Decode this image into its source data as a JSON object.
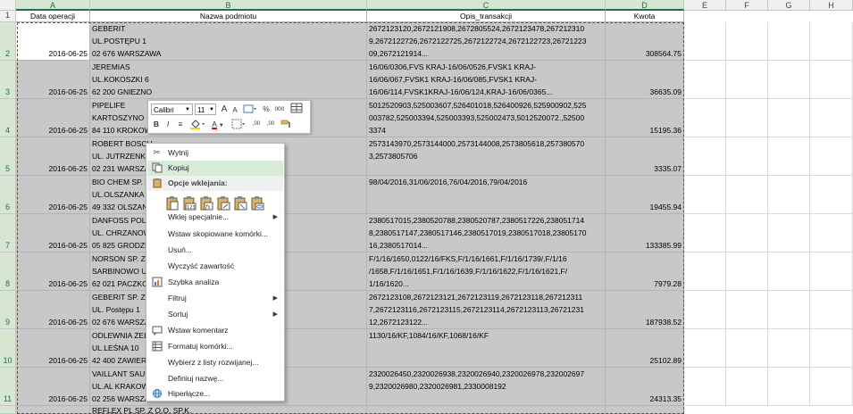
{
  "columns": [
    "A",
    "B",
    "C",
    "D",
    "E",
    "F",
    "G",
    "H"
  ],
  "rows": [
    "1",
    "2",
    "3",
    "4",
    "5",
    "6",
    "7",
    "8",
    "9",
    "10",
    "11"
  ],
  "headers": {
    "a": "Data operacji",
    "b": "Nazwa podmiotu",
    "c": "Opis_transakcji",
    "d": "Kwota"
  },
  "data_rows": [
    {
      "date": "2016-06-25",
      "name": [
        "GEBERIT",
        "UL.POSTĘPU 1",
        "02 676 WARSZAWA"
      ],
      "desc": [
        "2672123120,2672121908,2672805524,2672123478,267212310",
        "9,2672122726,2672122725,2672122724,2672122723,26721223",
        "09,2672121914..."
      ],
      "amount": "308564.75"
    },
    {
      "date": "2016-06-25",
      "name": [
        "JEREMIAS",
        "UL.KOKOSZKI 6",
        "62 200 GNIEZNO"
      ],
      "desc": [
        "16/06/0306,FVS KRAJ-16/06/0526,FVSK1 KRAJ-",
        "16/06/067,FVSK1 KRAJ-16/06/085,FVSK1 KRAJ-",
        "16/06/114,FVSK1KRAJ-16/06/124,KRAJ-16/06/0365..."
      ],
      "amount": "36635.09"
    },
    {
      "date": "2016-06-25",
      "name": [
        "PIPELIFE",
        "KARTOSZYNO",
        "84 110 KROKOWA"
      ],
      "desc": [
        "5012520903,525003607,526401018,526400926,525900902,525",
        "003782,525003394,525003393,525002473,5012520072.,52500",
        "3374"
      ],
      "amount": "15195.36"
    },
    {
      "date": "2016-06-25",
      "name": [
        "ROBERT BOSCH",
        "UL. JUTRZENKI",
        "02 231 WARSZAWA"
      ],
      "desc": [
        "",
        "2573143970,2573144000,2573144008,2573805618,257380570",
        "3,2573805706"
      ],
      "amount": "3335.07"
    },
    {
      "date": "2016-06-25",
      "name": [
        "BIO CHEM SP. Z",
        "UL.OLSZANKA",
        "49 332 OLSZANKA"
      ],
      "desc": [
        "",
        "",
        "98/04/2016,31/06/2016,76/04/2016,79/04/2016"
      ],
      "amount": "19455.94"
    },
    {
      "date": "2016-06-25",
      "name": [
        "DANFOSS POLAND",
        "UL. CHRZANOWSKA",
        "05 825 GRODZISK"
      ],
      "desc": [
        "2380517015,2380520788,2380520787,2380517226,238051714",
        "8,2380517147,2380517146,2380517019,2380517018,23805170",
        "16,2380517014..."
      ],
      "amount": "133385.99"
    },
    {
      "date": "2016-06-25",
      "name": [
        "NORSON SP. Z",
        "SARBINOWO UL.",
        "62 021 PACZKOWO"
      ],
      "desc": [
        "F/1/16/1650,0122/16/FKS,F/1/16/1661,F/1/16/1739/,F/1/16",
        "/1658,F/1/16/1651,F/1/16/1639,F/1/16/1622,F/1/16/1621,F/",
        "1/16/1620..."
      ],
      "amount": "7979.28"
    },
    {
      "date": "2016-06-25",
      "name": [
        "GEBERIT SP. Z",
        "UL. Postępu 1",
        "02 676 WARSZAWA"
      ],
      "desc": [
        "2672123108,2672123121,2672123119,2672123118,267212311",
        "7,2672123116,2672123115,2672123114,2672123113,26721231",
        "12,2672123122..."
      ],
      "amount": "187938.52"
    },
    {
      "date": "2016-06-25",
      "name": [
        "ODLEWNIA ŻELIWA",
        "UL.LEŚNA 10",
        "42 400 ZAWIERCIE"
      ],
      "desc": [
        "",
        "",
        "1130/16/KF,1084/16/KF,1068/16/KF"
      ],
      "amount": "25102.89"
    },
    {
      "date": "2016-06-25",
      "name": [
        "VAILLANT SAUNIER",
        "UL.AL KRAKOWSKA",
        "02 256 WARSZAWA"
      ],
      "desc": [
        "",
        "2320026450,2320026938,2320026940,2320026978,232002697",
        "9,2320026980,2320026981,2330008192"
      ],
      "amount": "24313.35"
    }
  ],
  "partial_row": {
    "name": "REFLEX PL SP. Z O.O. SP.K."
  },
  "mini_toolbar": {
    "font_name": "Calibri",
    "font_size": "11",
    "grow_font": "A",
    "shrink_font": "A",
    "percent": "%",
    "thousands": "000",
    "bold": "B",
    "italic": "I",
    "font_color": "A",
    "dec_inc": ",00",
    "dec_dec": ",00"
  },
  "context_menu": {
    "cut": "Wytnij",
    "copy": "Kopiuj",
    "paste_options_header": "Opcje wklejania:",
    "paste_special": "Wklej specjalnie...",
    "insert_copied": "Wstaw skopiowane komórki...",
    "delete": "Usuń...",
    "clear_contents": "Wyczyść zawartość",
    "quick_analysis": "Szybka analiza",
    "filter": "Filtruj",
    "sort": "Sortuj",
    "insert_comment": "Wstaw komentarz",
    "format_cells": "Formatuj komórki...",
    "pick_from_list": "Wybierz z listy rozwijanej...",
    "define_name": "Definiuj nazwę...",
    "hyperlink": "Hiperłącze..."
  },
  "colors": {
    "selection_fill": "#c8c8c8",
    "excel_green": "#217346",
    "menu_highlight": "#d6ebd8"
  }
}
